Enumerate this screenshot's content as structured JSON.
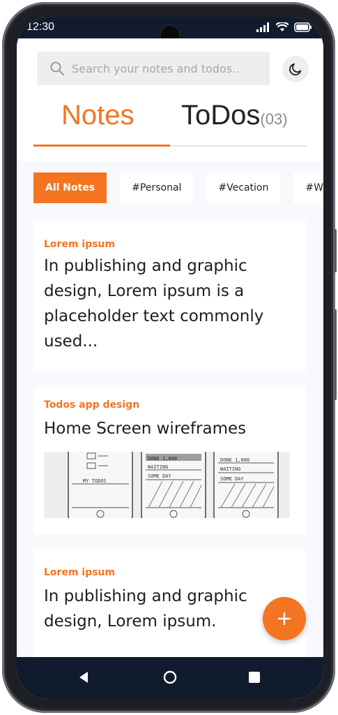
{
  "status_bar": {
    "time": "12:30"
  },
  "search": {
    "placeholder": "Search your notes and todos.."
  },
  "tabs": [
    {
      "label": "Notes",
      "active": true
    },
    {
      "label": "ToDos",
      "count": "(03)",
      "active": false
    }
  ],
  "filters": [
    "All Notes",
    "#Personal",
    "#Vecation",
    "#Work"
  ],
  "notes": [
    {
      "category": "Lorem ipsum",
      "text": "In publishing and graphic design, Lorem ipsum is a placeholder text commonly used..."
    },
    {
      "category": "Todos app design",
      "text": "Home Screen wireframes",
      "sketch": {
        "left_label": "MY TODOS",
        "middle_rows": [
          "DONE 1,000",
          "WAITING",
          "SOME DAY"
        ],
        "right_rows": [
          "DONE 1,000",
          "WAITING",
          "SOME DAY"
        ]
      }
    },
    {
      "category": "Lorem ipsum",
      "text": "In publishing and graphic design, Lorem ipsum."
    }
  ],
  "colors": {
    "accent": "#f47421",
    "bars": "#111b2e",
    "background": "#f8f9fc"
  },
  "icons": [
    "signal-icon",
    "wifi-icon",
    "battery-icon",
    "search-icon",
    "moon-icon",
    "plus-icon",
    "back-icon",
    "home-icon",
    "recents-icon"
  ]
}
